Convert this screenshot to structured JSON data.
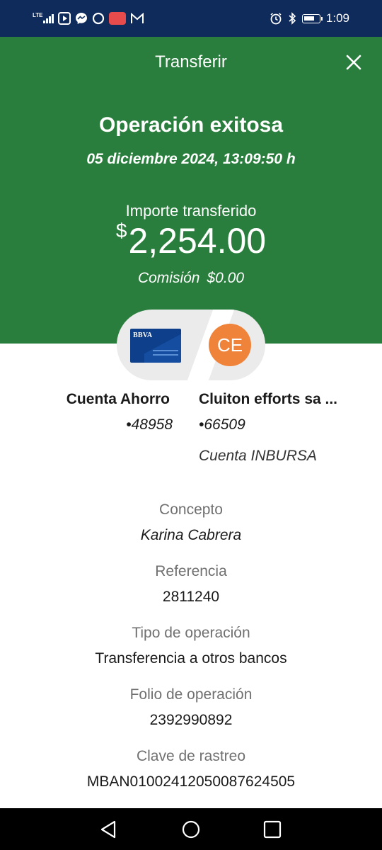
{
  "status_bar": {
    "network": "LTE",
    "time": "1:09",
    "left_icons": [
      "signal-icon",
      "play-icon",
      "messenger-icon",
      "circle-icon",
      "app-icon",
      "gmail-icon"
    ],
    "right_icons": [
      "alarm-icon",
      "bluetooth-icon",
      "battery-icon"
    ]
  },
  "header": {
    "title": "Transferir",
    "close_icon": "close-icon",
    "status_title": "Operación exitosa",
    "datetime": "05 diciembre 2024, 13:09:50 h",
    "amount_label": "Importe transferido",
    "amount_symbol": "$",
    "amount_value": "2,254.00",
    "commission_label": "Comisión",
    "commission_value": "$0.00",
    "background_color": "#2a7e3d"
  },
  "transfer": {
    "bank_logo_text": "BBVA",
    "recipient_initials": "CE",
    "avatar_color": "#f0833a",
    "from": {
      "name": "Cuenta Ahorro",
      "number": "•48958"
    },
    "to": {
      "name": "Cluiton efforts sa ...",
      "number": "•66509",
      "type": "Cuenta INBURSA"
    }
  },
  "details": [
    {
      "label": "Concepto",
      "value": "Karina Cabrera"
    },
    {
      "label": "Referencia",
      "value": "2811240"
    },
    {
      "label": "Tipo de operación",
      "value": "Transferencia a otros bancos"
    },
    {
      "label": "Folio de operación",
      "value": "2392990892"
    },
    {
      "label": "Clave de rastreo",
      "value": "MBAN01002412050087624505"
    }
  ],
  "nav_bar": {
    "buttons": [
      "back-icon",
      "home-icon",
      "recents-icon"
    ]
  }
}
